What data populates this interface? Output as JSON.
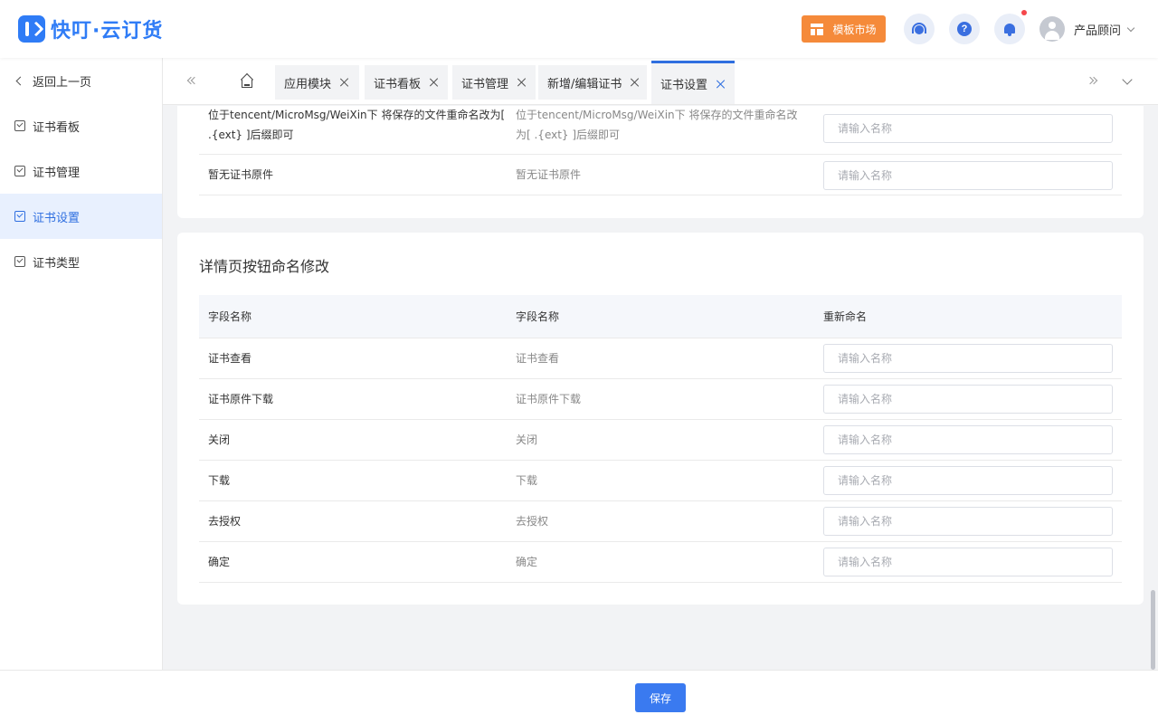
{
  "header": {
    "logo_text": "快叮·云订货",
    "template_market": "模板市场",
    "user_name": "产品顾问"
  },
  "sidebar": {
    "back": "返回上一页",
    "items": [
      {
        "label": "证书看板"
      },
      {
        "label": "证书管理"
      },
      {
        "label": "证书设置",
        "active": true
      },
      {
        "label": "证书类型"
      }
    ]
  },
  "tabs": [
    {
      "label": "应用模块"
    },
    {
      "label": "证书看板"
    },
    {
      "label": "证书管理"
    },
    {
      "label": "新增/编辑证书"
    },
    {
      "label": "证书设置",
      "active": true
    }
  ],
  "section1": {
    "rows": [
      {
        "name": "位于tencent/MicroMsg/WeiXin下 将保存的文件重命名改为[ .{ext} ]后缀即可",
        "value": "位于tencent/MicroMsg/WeiXin下 将保存的文件重命名改为[ .{ext} ]后缀即可",
        "placeholder": "请输入名称"
      },
      {
        "name": "暂无证书原件",
        "value": "暂无证书原件",
        "placeholder": "请输入名称"
      }
    ]
  },
  "section2": {
    "title": "详情页按钮命名修改",
    "columns": [
      "字段名称",
      "字段名称",
      "重新命名"
    ],
    "rows": [
      {
        "name": "证书查看",
        "value": "证书查看",
        "placeholder": "请输入名称"
      },
      {
        "name": "证书原件下载",
        "value": "证书原件下载",
        "placeholder": "请输入名称"
      },
      {
        "name": "关闭",
        "value": "关闭",
        "placeholder": "请输入名称"
      },
      {
        "name": "下载",
        "value": "下载",
        "placeholder": "请输入名称"
      },
      {
        "name": "去授权",
        "value": "去授权",
        "placeholder": "请输入名称"
      },
      {
        "name": "确定",
        "value": "确定",
        "placeholder": "请输入名称"
      }
    ]
  },
  "footer": {
    "save_label": "保存"
  },
  "colors": {
    "primary": "#3a7af0",
    "brand": "#2f7cf6",
    "template_button": "#f58a3a",
    "notification_dot": "#f5474b",
    "active_menu_bg": "#e8f0fe"
  }
}
